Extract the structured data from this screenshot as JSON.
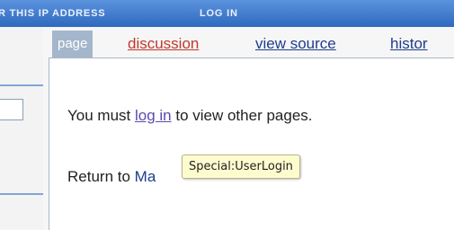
{
  "personal_bar": {
    "ip_label": "R THIS IP ADDRESS",
    "login_label": "LOG IN"
  },
  "tabs": [
    {
      "label": "page"
    },
    {
      "label": "discussion"
    },
    {
      "label": "view source"
    },
    {
      "label": "histor"
    }
  ],
  "content": {
    "message_before": "You must ",
    "login_link": "log in",
    "message_after": " to view other pages.",
    "return_prefix": "Return to ",
    "return_link": "Ma"
  },
  "tooltip": {
    "text": "Special:UserLogin"
  },
  "colors": {
    "personal_bar": "#3d78c8",
    "tab_selected_bg": "#a3b6cb",
    "discussion_link": "#c0392b",
    "link": "#1f3d8a",
    "visited_link": "#5a4bb0",
    "tooltip_bg": "#fdfccf"
  }
}
